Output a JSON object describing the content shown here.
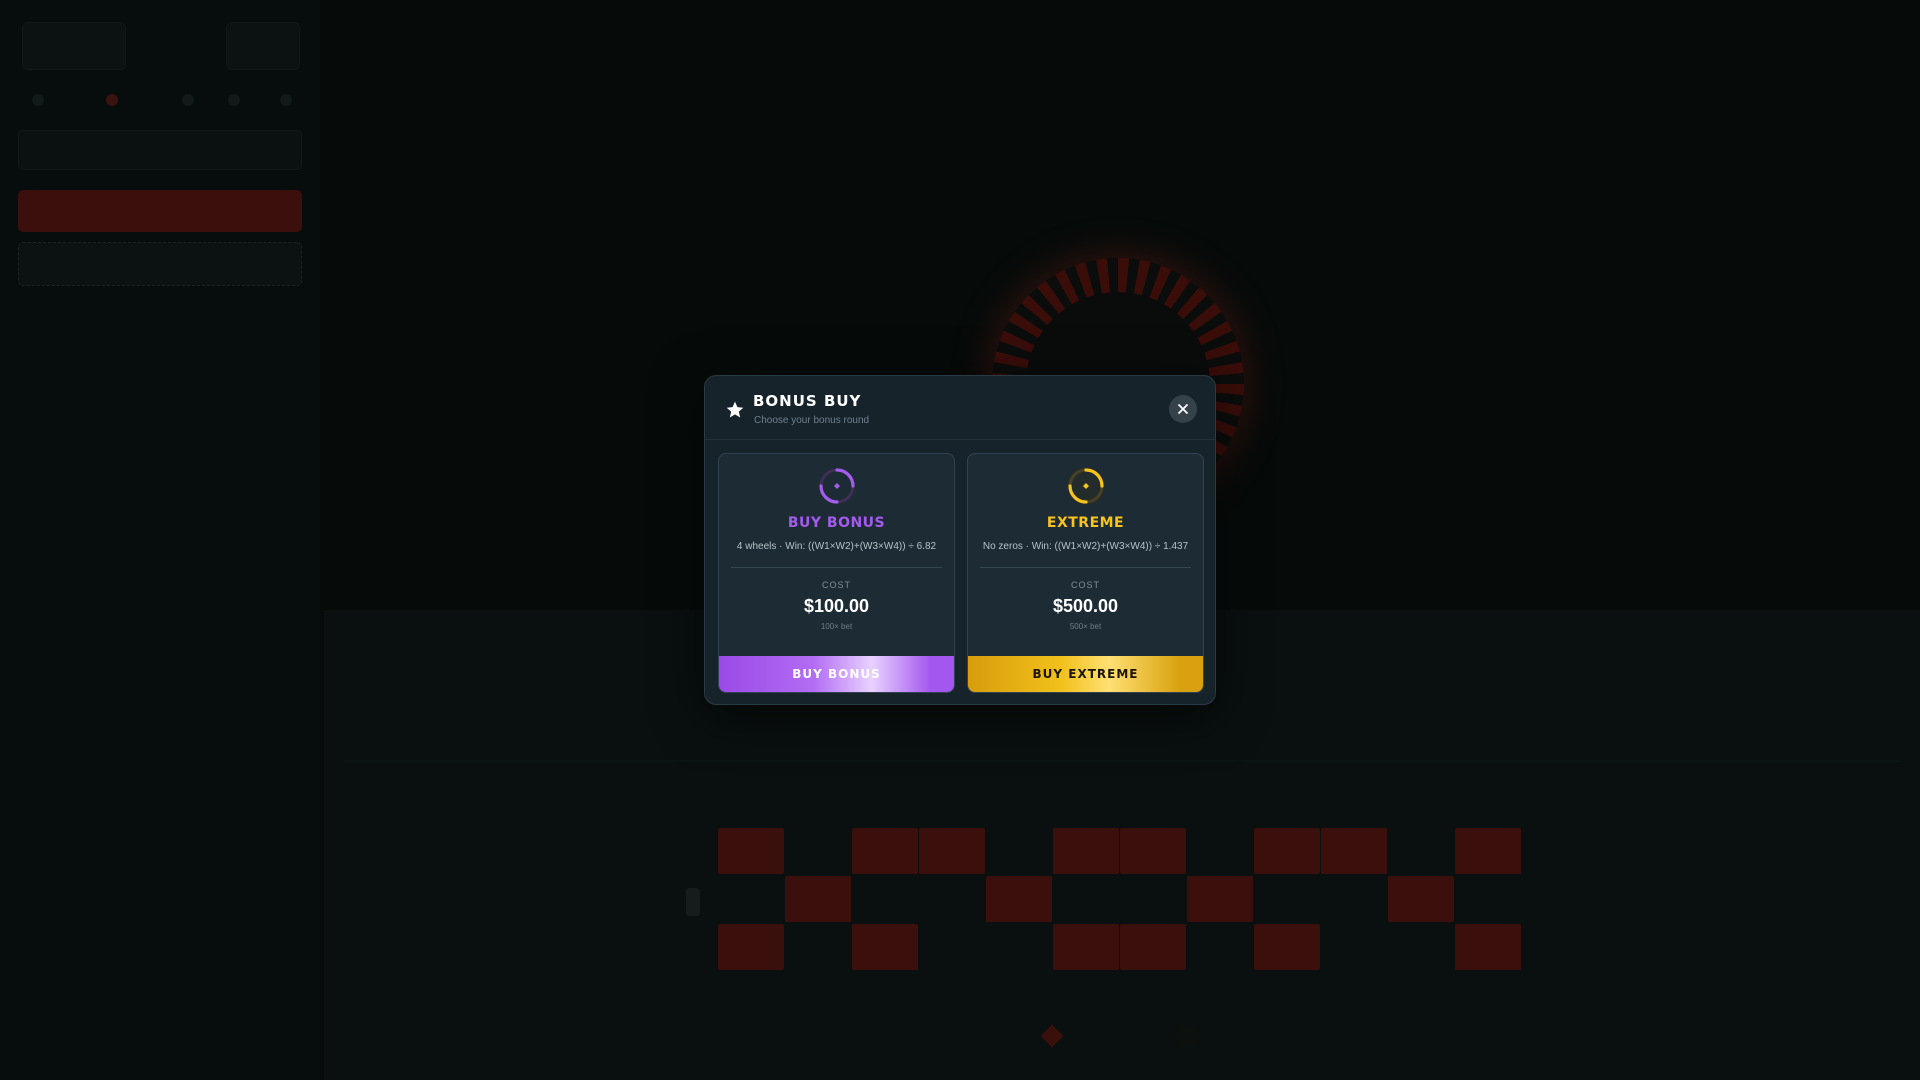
{
  "modal": {
    "title": "BONUS BUY",
    "subtitle": "Choose your bonus round",
    "close_icon": "close-icon",
    "title_icon": "star-icon"
  },
  "cards": [
    {
      "name": "BUY BONUS",
      "description": "4 wheels · Win: ((W1×W2)+(W3×W4)) ÷ 6.82",
      "cost_label": "COST",
      "cost": "$100.00",
      "multiplier": "100× bet",
      "button_label": "BUY BONUS",
      "accent_color": "#a45bee",
      "icon": "spinner-ring-icon"
    },
    {
      "name": "EXTREME",
      "description": "No zeros · Win: ((W1×W2)+(W3×W4)) ÷ 1.437",
      "cost_label": "COST",
      "cost": "$500.00",
      "multiplier": "500× bet",
      "button_label": "BUY EXTREME",
      "accent_color": "#f7c31c",
      "icon": "spinner-ring-icon"
    }
  ],
  "colors": {
    "background": "#060b0a",
    "modal_bg": "#17232b",
    "card_bg": "#1d2b35",
    "red_cell": "#3b0f0b"
  }
}
